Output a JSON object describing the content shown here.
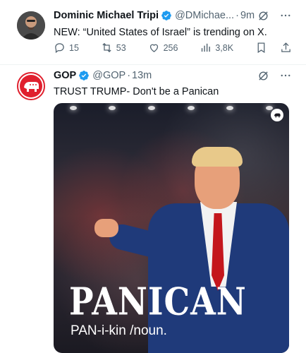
{
  "tweets": [
    {
      "author_name": "Dominic Michael Tripi",
      "handle": "@DMichae...",
      "separator": "·",
      "time": "9m",
      "text": "NEW: “United States of Israel” is trending on X.",
      "replies": "15",
      "retweets": "53",
      "likes": "256",
      "views": "3,8K"
    },
    {
      "author_name": "GOP",
      "handle": "@GOP",
      "separator": "·",
      "time": "13m",
      "text": "TRUST TRUMP- Don't be a Panican",
      "media": {
        "title": "PANICAN",
        "subtitle": "PAN-i-kin /noun."
      }
    }
  ],
  "colors": {
    "verified_blue": "#1d9bf0",
    "secondary_text": "#536471",
    "gop_red": "#e0202e"
  }
}
